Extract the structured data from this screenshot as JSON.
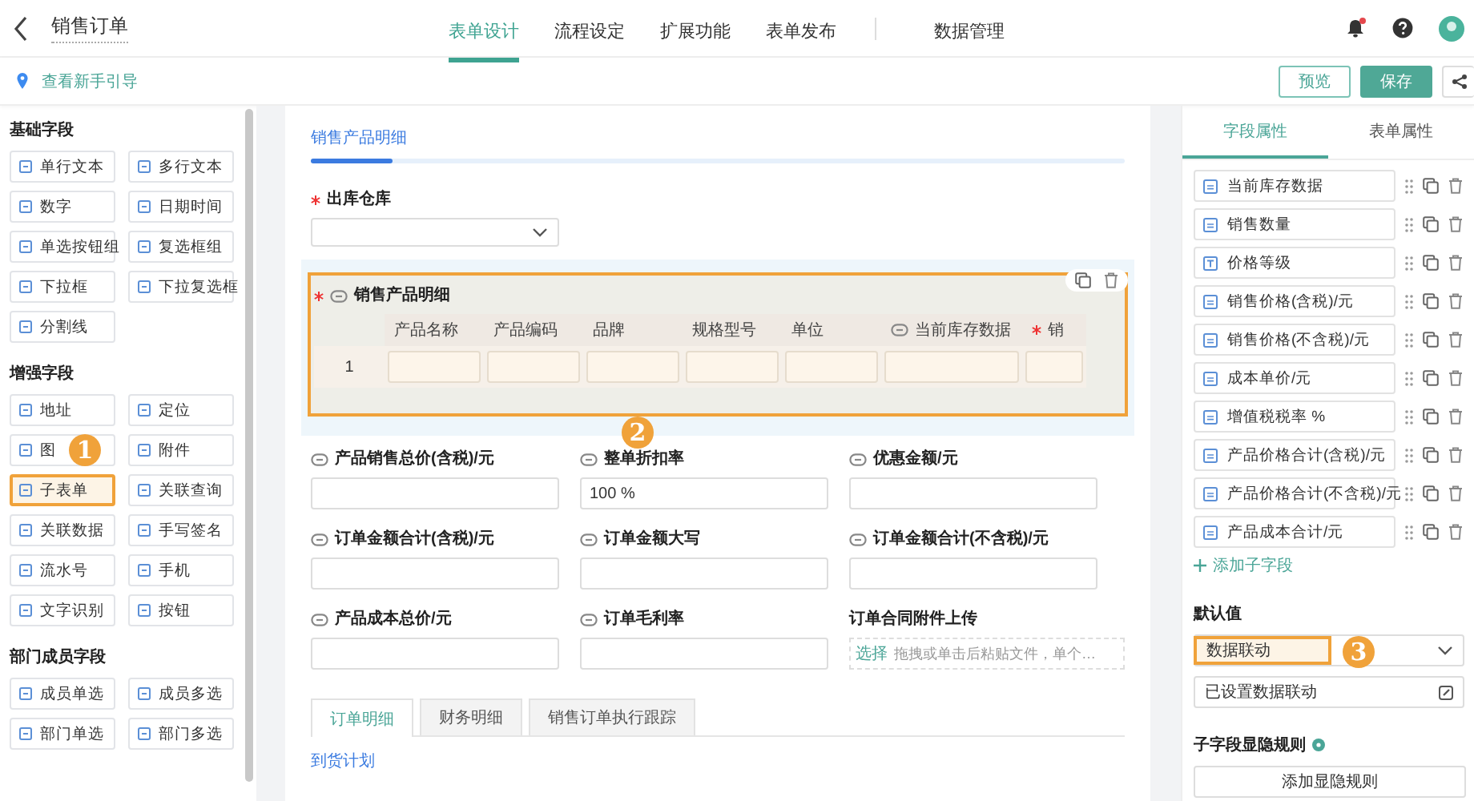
{
  "header": {
    "title": "销售订单",
    "nav": [
      {
        "label": "表单设计",
        "selected": true
      },
      {
        "label": "流程设定",
        "selected": false
      },
      {
        "label": "扩展功能",
        "selected": false
      },
      {
        "label": "表单发布",
        "selected": false
      }
    ],
    "nav_extra": [
      {
        "label": "数据管理",
        "selected": false
      }
    ]
  },
  "toolbar": {
    "guide": "查看新手引导",
    "preview": "预览",
    "save": "保存"
  },
  "palette": [
    {
      "title": "基础字段",
      "items": [
        {
          "label": "单行文本",
          "selected": false
        },
        {
          "label": "多行文本",
          "selected": false
        },
        {
          "label": "数字",
          "selected": false
        },
        {
          "label": "日期时间",
          "selected": false
        },
        {
          "label": "单选按钮组",
          "selected": false
        },
        {
          "label": "复选框组",
          "selected": false
        },
        {
          "label": "下拉框",
          "selected": false
        },
        {
          "label": "下拉复选框",
          "selected": false
        },
        {
          "label": "分割线",
          "selected": false
        }
      ]
    },
    {
      "title": "增强字段",
      "items": [
        {
          "label": "地址",
          "selected": false
        },
        {
          "label": "定位",
          "selected": false
        },
        {
          "label": "图",
          "selected": false,
          "callout": "1"
        },
        {
          "label": "附件",
          "selected": false
        },
        {
          "label": "子表单",
          "selected": true
        },
        {
          "label": "关联查询",
          "selected": false
        },
        {
          "label": "关联数据",
          "selected": false
        },
        {
          "label": "手写签名",
          "selected": false
        },
        {
          "label": "流水号",
          "selected": false
        },
        {
          "label": "手机",
          "selected": false
        },
        {
          "label": "文字识别",
          "selected": false
        },
        {
          "label": "按钮",
          "selected": false
        }
      ]
    },
    {
      "title": "部门成员字段",
      "items": [
        {
          "label": "成员单选",
          "selected": false
        },
        {
          "label": "成员多选",
          "selected": false
        },
        {
          "label": "部门单选",
          "selected": false
        },
        {
          "label": "部门多选",
          "selected": false
        }
      ]
    }
  ],
  "canvas": {
    "tab": "销售产品明细",
    "warehouse": {
      "label": "出库仓库",
      "required": true
    },
    "subtable": {
      "label": "销售产品明细",
      "required": true,
      "linked": true,
      "selected": true,
      "callout": "2",
      "row_number": "1",
      "columns": [
        {
          "label": "产品名称",
          "linked": false,
          "required": false
        },
        {
          "label": "产品编码",
          "linked": false,
          "required": false
        },
        {
          "label": "品牌",
          "linked": false,
          "required": false
        },
        {
          "label": "规格型号",
          "linked": false,
          "required": false
        },
        {
          "label": "单位",
          "linked": false,
          "required": false
        },
        {
          "label": "当前库存数据",
          "linked": true,
          "required": false
        },
        {
          "label": "销",
          "linked": false,
          "required": true
        }
      ]
    },
    "fields": [
      {
        "kind": "input",
        "label": "产品销售总价(含税)/元",
        "linked": true
      },
      {
        "kind": "input",
        "label": "整单折扣率",
        "linked": true,
        "value": "100 %"
      },
      {
        "kind": "input",
        "label": "优惠金额/元",
        "linked": true
      },
      {
        "kind": "input",
        "label": "订单金额合计(含税)/元",
        "linked": true
      },
      {
        "kind": "input",
        "label": "订单金额大写",
        "linked": true
      },
      {
        "kind": "input",
        "label": "订单金额合计(不含税)/元",
        "linked": true
      },
      {
        "kind": "input",
        "label": "产品成本总价/元",
        "linked": true
      },
      {
        "kind": "input",
        "label": "订单毛利率",
        "linked": true
      },
      {
        "kind": "upload",
        "label": "订单合同附件上传",
        "linked": false,
        "action": "选择",
        "hint": "拖拽或单击后粘贴文件，单个…"
      }
    ],
    "tabs": [
      {
        "label": "订单明细",
        "selected": true
      },
      {
        "label": "财务明细",
        "selected": false
      },
      {
        "label": "销售订单执行跟踪",
        "selected": false
      }
    ],
    "section": "到货计划"
  },
  "panel": {
    "tabs": [
      {
        "label": "字段属性",
        "selected": true
      },
      {
        "label": "表单属性",
        "selected": false
      }
    ],
    "subfields": [
      {
        "label": "当前库存数据",
        "kind": "number"
      },
      {
        "label": "销售数量",
        "kind": "number"
      },
      {
        "label": "价格等级",
        "kind": "text"
      },
      {
        "label": "销售价格(含税)/元",
        "kind": "number"
      },
      {
        "label": "销售价格(不含税)/元",
        "kind": "number"
      },
      {
        "label": "成本单价/元",
        "kind": "number"
      },
      {
        "label": "增值税税率 %",
        "kind": "number"
      },
      {
        "label": "产品价格合计(含税)/元",
        "kind": "number"
      },
      {
        "label": "产品价格合计(不含税)/元",
        "kind": "number"
      },
      {
        "label": "产品成本合计/元",
        "kind": "number"
      }
    ],
    "add_subfield": "添加子字段",
    "default_value": {
      "title": "默认值",
      "value": "数据联动",
      "callout": "3",
      "status": "已设置数据联动"
    },
    "rules": {
      "title": "子字段显隐规则",
      "button": "添加显隐规则"
    }
  }
}
